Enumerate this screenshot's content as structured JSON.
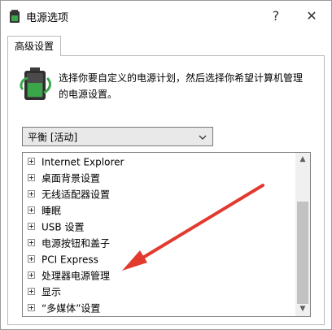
{
  "window": {
    "title": "电源选项",
    "help_glyph": "?",
    "close_glyph": "✕"
  },
  "tab": {
    "label": "高级设置"
  },
  "description": "选择你要自定义的电源计划，然后选择你希望计算机管理的电源设置。",
  "scheme": {
    "selected": "平衡 [活动]"
  },
  "tree": {
    "items": [
      {
        "label": "Internet Explorer"
      },
      {
        "label": "桌面背景设置"
      },
      {
        "label": "无线适配器设置"
      },
      {
        "label": "睡眠"
      },
      {
        "label": "USB 设置"
      },
      {
        "label": "电源按钮和盖子"
      },
      {
        "label": "PCI Express"
      },
      {
        "label": "处理器电源管理"
      },
      {
        "label": "显示"
      },
      {
        "label": "“多媒体”设置"
      }
    ]
  },
  "icons": {
    "app": "battery-app-icon",
    "battery": "battery-plan-icon",
    "expand": "expand-plus-icon",
    "chevron": "chevron-down-icon",
    "annotation": "red-arrow-annotation"
  },
  "colors": {
    "annotation_arrow": "#e23a2e",
    "battery_green": "#3aa64a"
  }
}
